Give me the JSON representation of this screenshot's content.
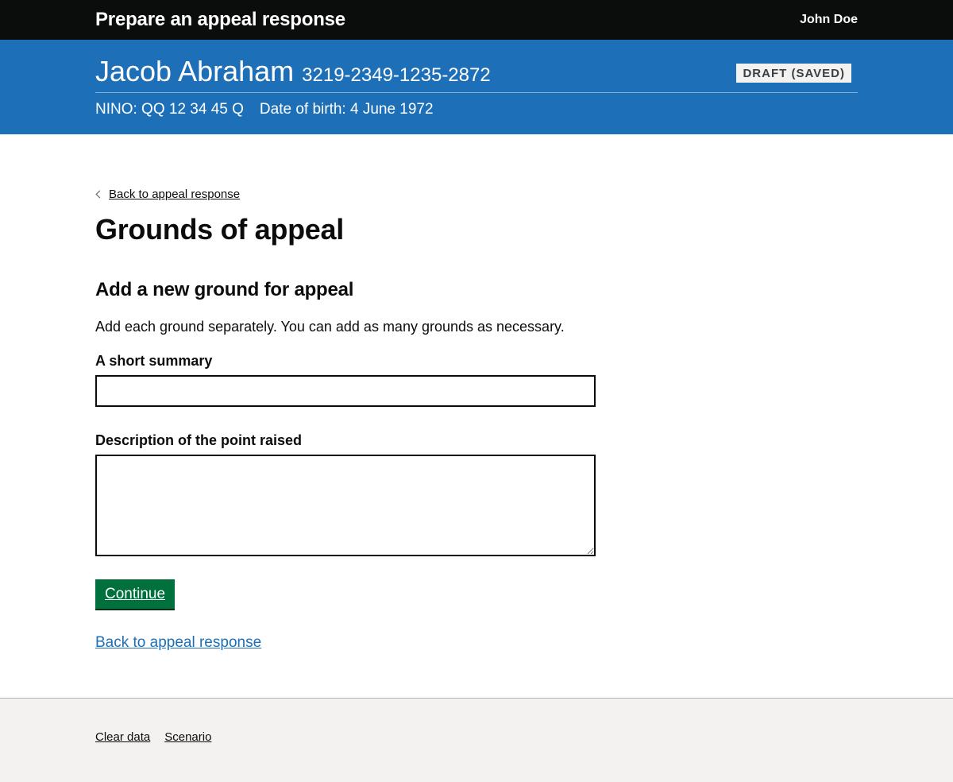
{
  "header": {
    "service_name": "Prepare an appeal response",
    "user_name": "John Doe"
  },
  "banner": {
    "person_name": "Jacob Abraham",
    "reference": "3219-2349-1235-2872",
    "status": "DRAFT (SAVED)",
    "nino": "NINO: QQ 12 34 45 Q",
    "dob": "Date of birth: 4 June 1972"
  },
  "main": {
    "back_link": "Back to appeal response",
    "title": "Grounds of appeal",
    "section_heading": "Add a new ground for appeal",
    "hint": "Add each ground separately. You can add as many grounds as necessary.",
    "summary_label": "A short summary",
    "summary_value": "",
    "description_label": "Description of the point raised",
    "description_value": "",
    "continue_button": "Continue",
    "bottom_back_link": "Back to appeal response"
  },
  "footer": {
    "links": [
      "Clear data",
      "Scenario"
    ]
  },
  "colors": {
    "header_bg": "#0b0c0c",
    "banner_bg": "#1d70b8",
    "button_bg": "#00703c",
    "link": "#1d70b8",
    "footer_bg": "#f3f2f1"
  }
}
